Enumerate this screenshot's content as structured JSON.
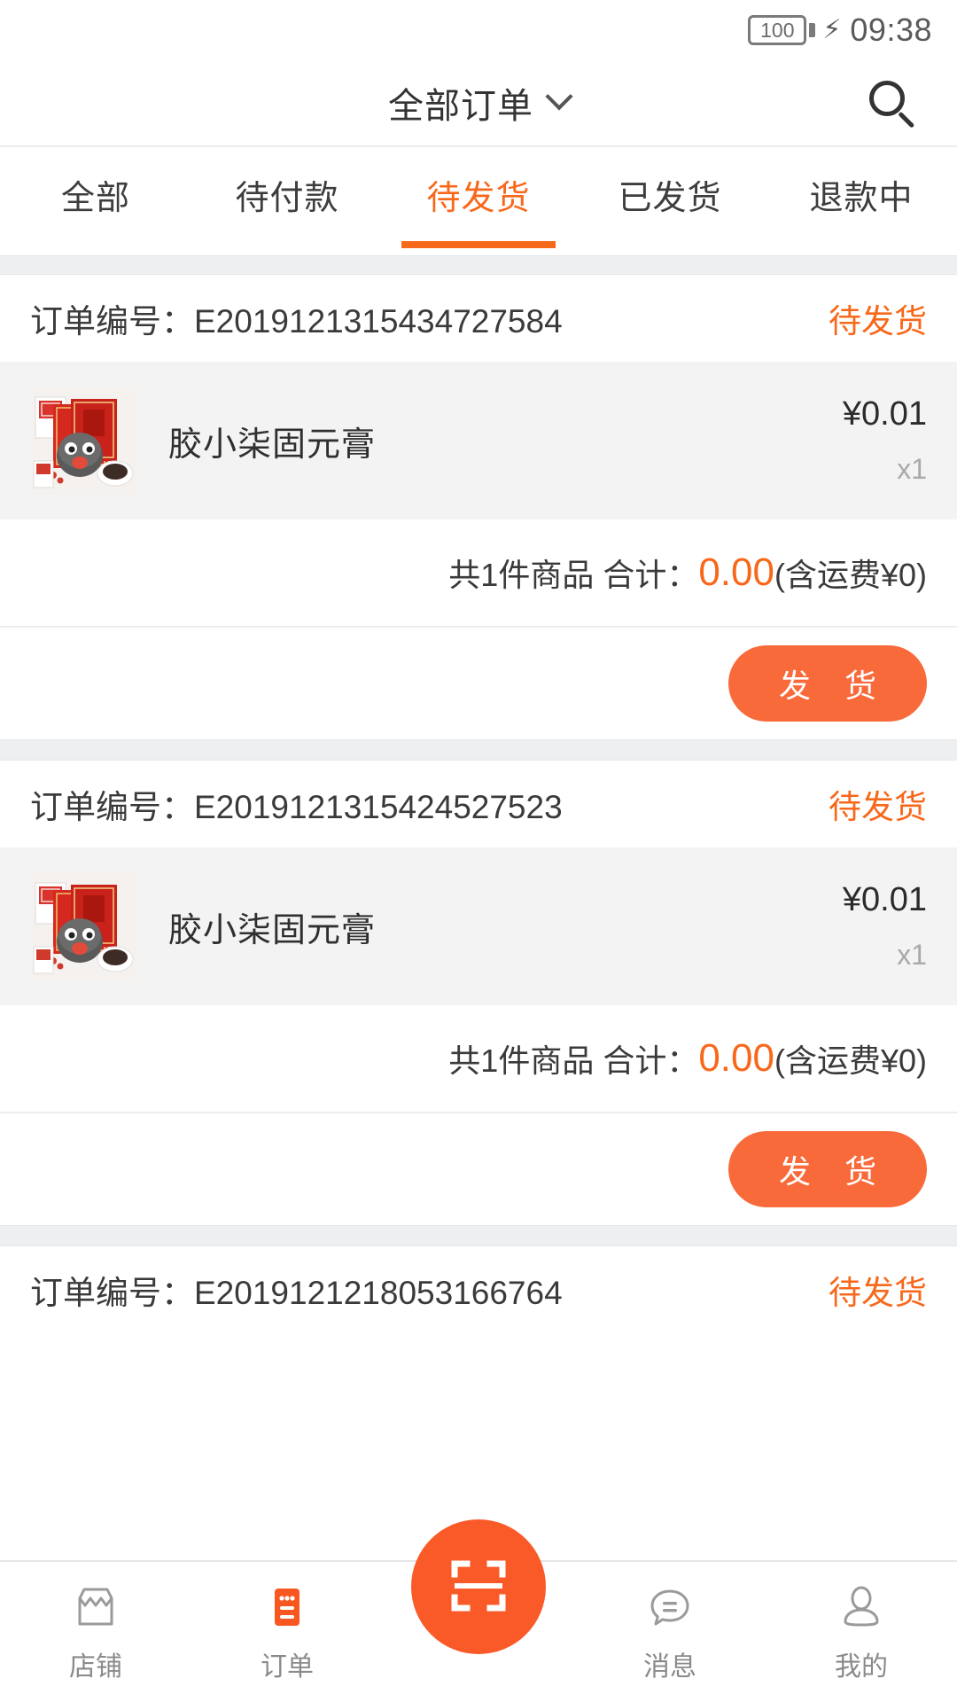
{
  "status_bar": {
    "battery_level": "100",
    "charging_icon": "bolt-icon",
    "time": "09:38"
  },
  "header": {
    "title": "全部订单",
    "dropdown_icon": "chevron-down-icon",
    "search_icon": "search-icon"
  },
  "tabs": [
    {
      "label": "全部",
      "active": false
    },
    {
      "label": "待付款",
      "active": false
    },
    {
      "label": "待发货",
      "active": true
    },
    {
      "label": "已发货",
      "active": false
    },
    {
      "label": "退款中",
      "active": false
    }
  ],
  "order_labels": {
    "order_no_label": "订单编号：",
    "totals_prefix": "共1件商品 合计：",
    "totals_suffix": "(含运费¥0)",
    "ship_button": "发 货"
  },
  "orders": [
    {
      "order_no_label": "订单编号：",
      "order_no": "E2019121315434727584",
      "status": "待发货",
      "product": {
        "title": "胶小柒固元膏",
        "price": "¥0.01",
        "qty": "x1",
        "image": "product-thumbnail-gift-box"
      },
      "totals_prefix": "共1件商品 合计：",
      "totals_amount": "0.00",
      "totals_suffix": "(含运费¥0)",
      "action": "发 货"
    },
    {
      "order_no_label": "订单编号：",
      "order_no": "E2019121315424527523",
      "status": "待发货",
      "product": {
        "title": "胶小柒固元膏",
        "price": "¥0.01",
        "qty": "x1",
        "image": "product-thumbnail-gift-box"
      },
      "totals_prefix": "共1件商品 合计：",
      "totals_amount": "0.00",
      "totals_suffix": "(含运费¥0)",
      "action": "发 货"
    },
    {
      "order_no_label": "订单编号：",
      "order_no": "E2019121218053166764",
      "status": "待发货"
    }
  ],
  "bottom_nav": {
    "items": [
      {
        "label": "店铺",
        "icon": "store-icon",
        "active": false
      },
      {
        "label": "订单",
        "icon": "order-list-icon",
        "active": true
      },
      {
        "label": "消息",
        "icon": "chat-bubble-icon",
        "active": false
      },
      {
        "label": "我的",
        "icon": "person-icon",
        "active": false
      }
    ],
    "fab_icon": "scan-qr-icon"
  },
  "colors": {
    "accent": "#f8681b",
    "fab": "#fa5a28",
    "button": "#f96a3a",
    "text": "#3a3a3a",
    "muted": "#a9a9a9",
    "product_bg": "#f3f3f3",
    "divider_band": "#edeff1"
  }
}
